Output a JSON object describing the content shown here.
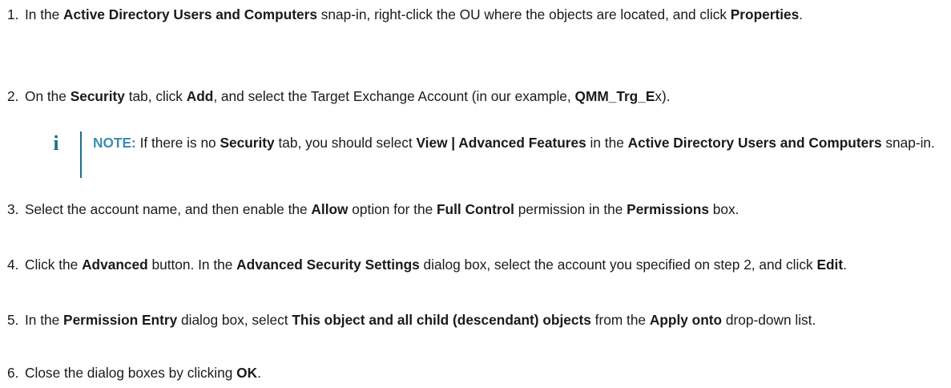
{
  "steps": [
    {
      "num": "1.",
      "parts": [
        {
          "t": "In the "
        },
        {
          "b": "Active Directory Users and Computers"
        },
        {
          "t": " snap-in, right-click the OU where the objects are located, and click "
        },
        {
          "b": "Properties"
        },
        {
          "t": "."
        }
      ]
    },
    {
      "num": "2.",
      "parts": [
        {
          "t": "On the "
        },
        {
          "b": "Security"
        },
        {
          "t": " tab, click "
        },
        {
          "b": "Add"
        },
        {
          "t": ", and select the Target Exchange Account (in our example, "
        },
        {
          "b": "QMM_Trg_E"
        },
        {
          "t": "x)."
        }
      ]
    },
    {
      "num": "3.",
      "parts": [
        {
          "t": "Select the account name, and then enable the "
        },
        {
          "b": "Allow"
        },
        {
          "t": " option for the "
        },
        {
          "b": "Full Control"
        },
        {
          "t": " permission in the "
        },
        {
          "b": "Permissions"
        },
        {
          "t": " box."
        }
      ]
    },
    {
      "num": "4.",
      "parts": [
        {
          "t": "Click the "
        },
        {
          "b": "Advanced"
        },
        {
          "t": " button. In the "
        },
        {
          "b": "Advanced Security Settings"
        },
        {
          "t": " dialog box, select the account you specified on step 2, and click "
        },
        {
          "b": "Edit"
        },
        {
          "t": "."
        }
      ]
    },
    {
      "num": "5.",
      "parts": [
        {
          "t": "In the "
        },
        {
          "b": "Permission Entry"
        },
        {
          "t": " dialog box, select "
        },
        {
          "b": "This object and all child (descendant) objects"
        },
        {
          "t": " from the "
        },
        {
          "b": "Apply onto"
        },
        {
          "t": " drop-down list."
        }
      ]
    },
    {
      "num": "6.",
      "parts": [
        {
          "t": "Close the dialog boxes by clicking "
        },
        {
          "b": "OK"
        },
        {
          "t": "."
        }
      ]
    }
  ],
  "note": {
    "icon": "info-icon",
    "icon_glyph": "i",
    "color": "#1f6f8b",
    "label": "NOTE:",
    "parts": [
      {
        "t": " If there is no "
      },
      {
        "b": "Security"
      },
      {
        "t": " tab, you should select "
      },
      {
        "b": "View | Advanced Features"
      },
      {
        "t": " in the "
      },
      {
        "b": "Active Directory Users and Computers"
      },
      {
        "t": " snap-in."
      }
    ]
  }
}
